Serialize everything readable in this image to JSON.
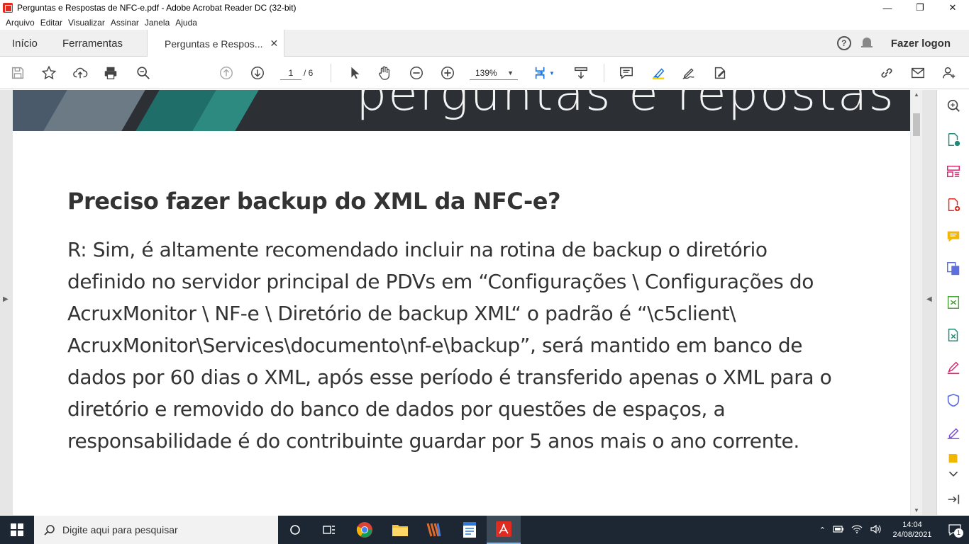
{
  "window": {
    "title": "Perguntas e Respostas de NFC-e.pdf - Adobe Acrobat Reader DC (32-bit)"
  },
  "menu": [
    "Arquivo",
    "Editar",
    "Visualizar",
    "Assinar",
    "Janela",
    "Ajuda"
  ],
  "tabs": {
    "home": "Início",
    "tools": "Ferramentas",
    "doc": "Perguntas e Respos..."
  },
  "account": {
    "login": "Fazer logon"
  },
  "toolbar": {
    "current_page": "1",
    "total_pages": "/ 6",
    "zoom": "139%"
  },
  "document": {
    "banner_title": "perguntas e repostas",
    "heading": "Preciso fazer backup do XML da NFC-e?",
    "answer_lines": [
      "R: Sim, é altamente recomendado incluir na rotina de backup o diretório",
      "definido no servidor principal de PDVs em “Configurações \\ Configurações do",
      "AcruxMonitor \\ NF-e \\ Diretório de backup XML“ o padrão é “\\c5client\\",
      "AcruxMonitor\\Services\\documento\\nf-e\\backup”, será mantido em banco de",
      "dados por 60 dias o XML, após esse período é transferido apenas o XML para o",
      "diretório e removido do banco de dados por questões de espaços, a",
      "responsabilidade é do contribuinte guardar por 5 anos mais o ano corrente."
    ]
  },
  "taskbar": {
    "search_placeholder": "Digite aqui para pesquisar",
    "time": "14:04",
    "date": "24/08/2021",
    "notifications": "1"
  },
  "colors": {
    "acrobat_red": "#e02b20",
    "taskbar": "#1c2733",
    "accent_blue": "#1473e6"
  }
}
